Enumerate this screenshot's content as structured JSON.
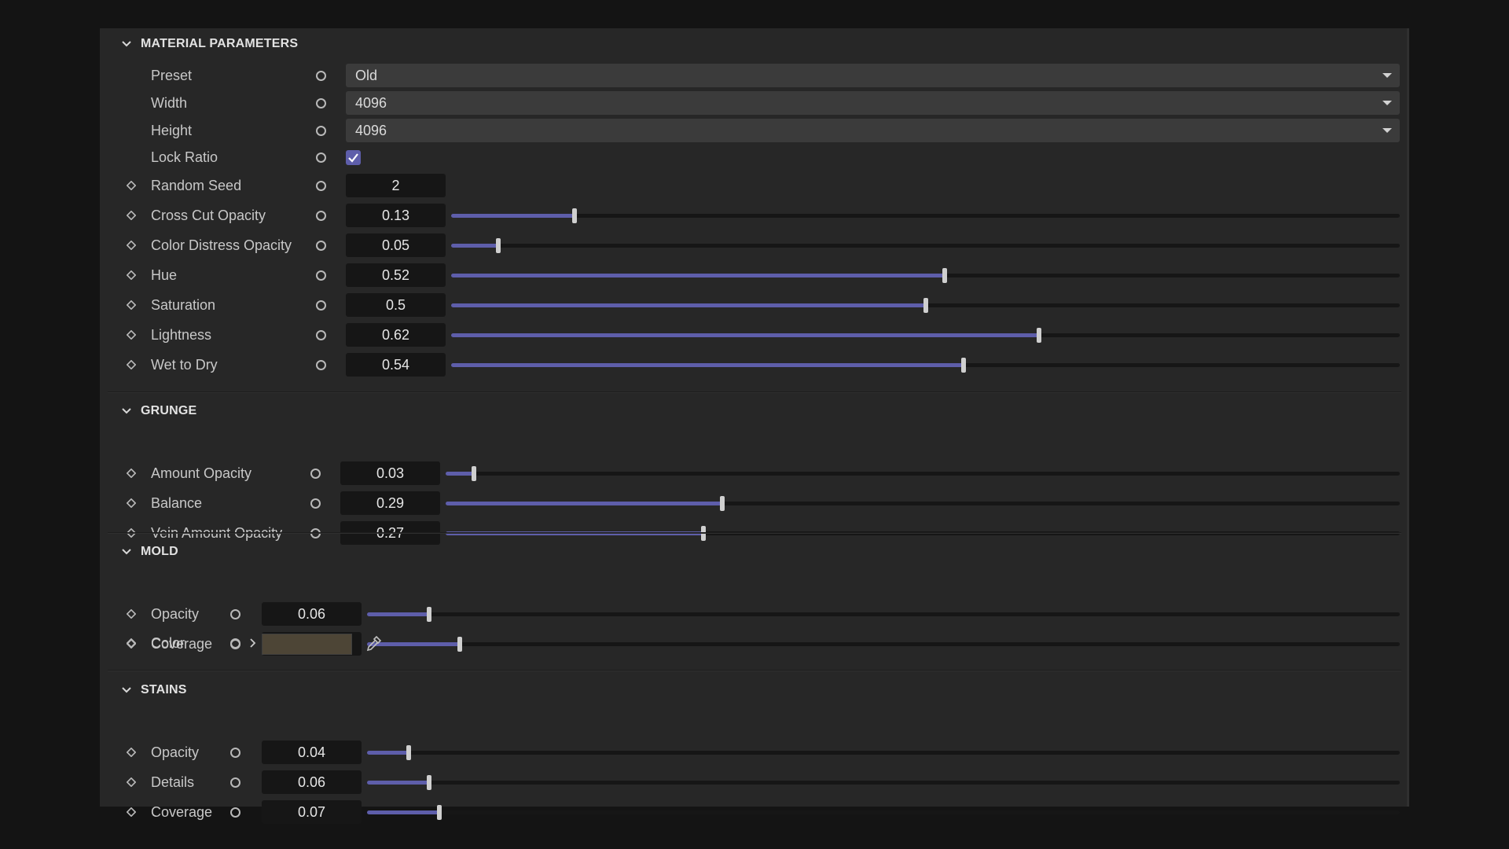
{
  "panel": {
    "accent_color": "#5e5eaa",
    "background_color": "#272727"
  },
  "material": {
    "title": "MATERIAL PARAMETERS",
    "preset": {
      "label": "Preset",
      "value": "Old"
    },
    "width": {
      "label": "Width",
      "value": "4096"
    },
    "height": {
      "label": "Height",
      "value": "4096"
    },
    "lock_ratio": {
      "label": "Lock Ratio",
      "checked": true
    },
    "random_seed": {
      "label": "Random Seed",
      "value": "2"
    },
    "sliders": [
      {
        "label": "Cross Cut Opacity",
        "value": "0.13",
        "fraction": 0.13
      },
      {
        "label": "Color Distress Opacity",
        "value": "0.05",
        "fraction": 0.05
      },
      {
        "label": "Hue",
        "value": "0.52",
        "fraction": 0.52
      },
      {
        "label": "Saturation",
        "value": "0.5",
        "fraction": 0.5
      },
      {
        "label": "Lightness",
        "value": "0.62",
        "fraction": 0.62
      },
      {
        "label": "Wet to Dry",
        "value": "0.54",
        "fraction": 0.54
      }
    ]
  },
  "grunge": {
    "title": "GRUNGE",
    "sliders": [
      {
        "label": "Amount Opacity",
        "value": "0.03",
        "fraction": 0.03
      },
      {
        "label": "Balance",
        "value": "0.29",
        "fraction": 0.29
      },
      {
        "label": "Vein Amount Opacity",
        "value": "0.27",
        "fraction": 0.27
      }
    ]
  },
  "mold": {
    "title": "MOLD",
    "sliders": [
      {
        "label": "Opacity",
        "value": "0.06",
        "fraction": 0.06
      },
      {
        "label": "Coverage",
        "value": "0.09",
        "fraction": 0.09
      }
    ],
    "color": {
      "label": "Color",
      "swatch": "#4d4536"
    }
  },
  "stains": {
    "title": "STAINS",
    "sliders": [
      {
        "label": "Opacity",
        "value": "0.04",
        "fraction": 0.04
      },
      {
        "label": "Details",
        "value": "0.06",
        "fraction": 0.06
      },
      {
        "label": "Coverage",
        "value": "0.07",
        "fraction": 0.07
      }
    ]
  },
  "icons": {
    "collapse": "chevron-down-icon",
    "keyframe": "diamond-keyframe-icon",
    "reset": "circle-reset-icon",
    "expand": "chevron-right-icon",
    "eyedropper": "eyedropper-icon",
    "check": "checkmark-icon"
  }
}
